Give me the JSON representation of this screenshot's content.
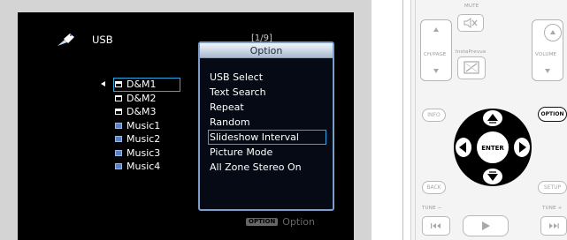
{
  "screen": {
    "source_label": "USB",
    "page_indicator": "[1/9]",
    "file_list": [
      {
        "name": "D&M1",
        "type": "folder",
        "selected": true
      },
      {
        "name": "D&M2",
        "type": "folder",
        "selected": false
      },
      {
        "name": "D&M3",
        "type": "folder",
        "selected": false
      },
      {
        "name": "Music1",
        "type": "music",
        "selected": false
      },
      {
        "name": "Music2",
        "type": "music",
        "selected": false
      },
      {
        "name": "Music3",
        "type": "music",
        "selected": false
      },
      {
        "name": "Music4",
        "type": "music",
        "selected": false
      }
    ],
    "option_hint_badge": "OPTION",
    "option_hint_label": "Option"
  },
  "option_menu": {
    "title": "Option",
    "items": [
      {
        "label": "USB Select",
        "selected": false
      },
      {
        "label": "Text Search",
        "selected": false
      },
      {
        "label": "Repeat",
        "selected": false
      },
      {
        "label": "Random",
        "selected": false
      },
      {
        "label": "Slideshow Interval",
        "selected": true
      },
      {
        "label": "Picture Mode",
        "selected": false
      },
      {
        "label": "All Zone Stereo On",
        "selected": false
      }
    ]
  },
  "remote": {
    "mute_label": "MUTE",
    "ch_page_label": "CH/PAGE",
    "insta_label": "InstaPrevue",
    "volume_label": "VOLUME",
    "info_label": "INFO",
    "option_label": "OPTION",
    "enter_label": "ENTER",
    "back_label": "BACK",
    "setup_label": "SETUP",
    "tune_minus_label": "TUNE −",
    "tune_plus_label": "TUNE +"
  },
  "colors": {
    "highlight": "#2aa8e4",
    "popup_border": "#7c9ecc",
    "screen_bg": "#000000"
  }
}
